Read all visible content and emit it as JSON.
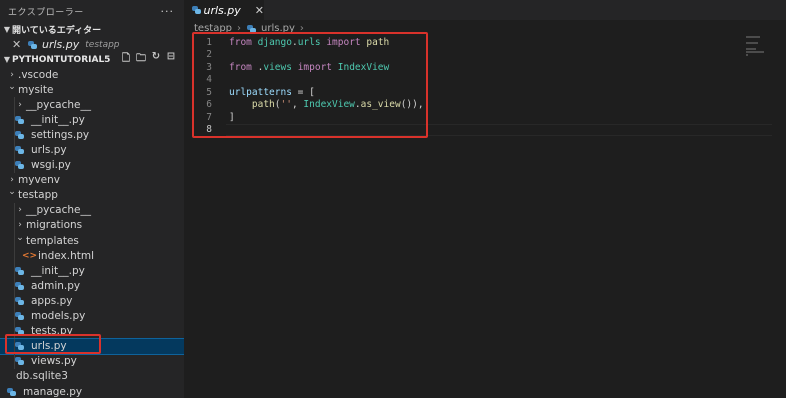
{
  "explorer": {
    "title": "エクスプローラー",
    "more_label": "···",
    "open_editors_label": "開いているエディター",
    "open_editor": {
      "name": "urls.py",
      "dir": "testapp"
    },
    "project_label": "PYTHONTUTORIAL5",
    "tree": [
      {
        "label": ".vscode",
        "type": "folder",
        "state": "collapsed",
        "indent": 0
      },
      {
        "label": "mysite",
        "type": "folder",
        "state": "expanded",
        "indent": 0
      },
      {
        "label": "__pycache__",
        "type": "folder",
        "state": "collapsed",
        "indent": 1
      },
      {
        "label": "__init__.py",
        "type": "py",
        "indent": 1
      },
      {
        "label": "settings.py",
        "type": "py",
        "indent": 1
      },
      {
        "label": "urls.py",
        "type": "py",
        "indent": 1
      },
      {
        "label": "wsgi.py",
        "type": "py",
        "indent": 1
      },
      {
        "label": "myvenv",
        "type": "folder",
        "state": "collapsed",
        "indent": 0
      },
      {
        "label": "testapp",
        "type": "folder",
        "state": "expanded",
        "indent": 0
      },
      {
        "label": "__pycache__",
        "type": "folder",
        "state": "collapsed",
        "indent": 1
      },
      {
        "label": "migrations",
        "type": "folder",
        "state": "collapsed",
        "indent": 1
      },
      {
        "label": "templates",
        "type": "folder",
        "state": "expanded",
        "indent": 1
      },
      {
        "label": "index.html",
        "type": "html",
        "indent": 2
      },
      {
        "label": "__init__.py",
        "type": "py",
        "indent": 1
      },
      {
        "label": "admin.py",
        "type": "py",
        "indent": 1
      },
      {
        "label": "apps.py",
        "type": "py",
        "indent": 1
      },
      {
        "label": "models.py",
        "type": "py",
        "indent": 1
      },
      {
        "label": "tests.py",
        "type": "py",
        "indent": 1
      },
      {
        "label": "urls.py",
        "type": "py",
        "indent": 1,
        "selected": true
      },
      {
        "label": "views.py",
        "type": "py",
        "indent": 1
      },
      {
        "label": "db.sqlite3",
        "type": "file",
        "indent": 0
      },
      {
        "label": "manage.py",
        "type": "py",
        "indent": 0
      }
    ]
  },
  "editor": {
    "tab": {
      "name": "urls.py",
      "close_glyph": "✕"
    },
    "breadcrumb": {
      "folder": "testapp",
      "file": "urls.py"
    },
    "active_line": 8,
    "lines": [
      [
        {
          "t": "from",
          "c": "kw"
        },
        {
          "t": " ",
          "c": "pl"
        },
        {
          "t": "django",
          "c": "mod"
        },
        {
          "t": ".",
          "c": "pl"
        },
        {
          "t": "urls",
          "c": "mod"
        },
        {
          "t": " ",
          "c": "pl"
        },
        {
          "t": "import",
          "c": "kw"
        },
        {
          "t": " ",
          "c": "pl"
        },
        {
          "t": "path",
          "c": "fn"
        }
      ],
      [],
      [
        {
          "t": "from",
          "c": "kw"
        },
        {
          "t": " .",
          "c": "pl"
        },
        {
          "t": "views",
          "c": "mod"
        },
        {
          "t": " ",
          "c": "pl"
        },
        {
          "t": "import",
          "c": "kw"
        },
        {
          "t": " ",
          "c": "pl"
        },
        {
          "t": "IndexView",
          "c": "mod"
        }
      ],
      [],
      [
        {
          "t": "urlpatterns",
          "c": "var"
        },
        {
          "t": " = [",
          "c": "pl"
        }
      ],
      [
        {
          "t": "    ",
          "c": "pl"
        },
        {
          "t": "path",
          "c": "fn"
        },
        {
          "t": "(",
          "c": "pl"
        },
        {
          "t": "''",
          "c": "str"
        },
        {
          "t": ", ",
          "c": "pl"
        },
        {
          "t": "IndexView",
          "c": "mod"
        },
        {
          "t": ".",
          "c": "pl"
        },
        {
          "t": "as_view",
          "c": "fn"
        },
        {
          "t": "()),",
          "c": "pl"
        }
      ],
      [
        {
          "t": "]",
          "c": "pl"
        }
      ],
      []
    ]
  },
  "colors": {
    "highlight_box": "#d9322b",
    "sidebar_bg": "#252526",
    "editor_bg": "#1e1e1e",
    "selection_bg": "#04395e"
  },
  "icons": [
    "close-icon",
    "chevron-down-icon",
    "chevron-right-icon",
    "new-file-icon",
    "new-folder-icon",
    "refresh-icon",
    "collapse-all-icon",
    "python-file-icon",
    "html-file-icon"
  ]
}
